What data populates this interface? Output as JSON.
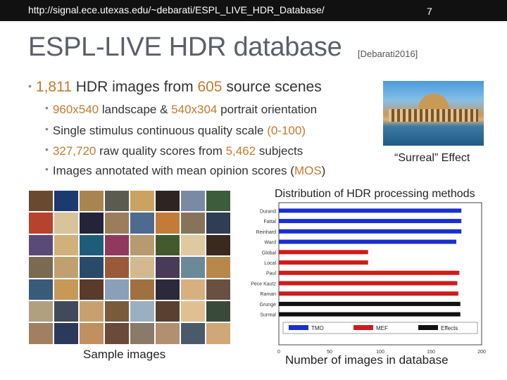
{
  "header": {
    "url": "http://signal.ece.utexas.edu/~debarati/ESPL_LIVE_HDR_Database/",
    "page_number": "7"
  },
  "slide": {
    "title": "ESPL-LIVE HDR database",
    "citation": "[Debarati2016]",
    "bullet": {
      "pre": "1,811",
      "mid1": " HDR images from ",
      "num2": "605",
      "post": " source scenes"
    },
    "subbullets": [
      {
        "a": "960x540",
        "b": " landscape & ",
        "c": "540x304",
        "d": " portrait orientation"
      },
      {
        "a": "Single stimulus continuous quality scale ",
        "b": "(0-100)"
      },
      {
        "a": "327,720",
        "b": " raw quality scores from ",
        "c": "5,462",
        "d": " subjects"
      },
      {
        "a": "Images annotated with mean opinion scores (",
        "b": "MOS",
        "c": ")"
      }
    ],
    "photo_caption": "“Surreal” Effect",
    "chart_caption": "Distribution of HDR processing methods",
    "sample_caption": "Sample images",
    "x_caption": "Number of images in database",
    "highlight_color": "#c37a2e",
    "sample_tile_colors": [
      "#6a4a2e",
      "#1d3a6e",
      "#a88550",
      "#5b5b50",
      "#c9a35f",
      "#2e2420",
      "#7b8aa4",
      "#3c5c3a",
      "#b7432f",
      "#d8c39a",
      "#23233a",
      "#9c7d5a",
      "#4e6b8f",
      "#c47b3a",
      "#86735a",
      "#2f3d55",
      "#5a4a78",
      "#d2b07a",
      "#1e5d7a",
      "#8f3a5c",
      "#b89a70",
      "#435a2e",
      "#e0c8a0",
      "#3a2a1e",
      "#7a6a52",
      "#c0a070",
      "#2a4a6a",
      "#9a5a3a",
      "#d4b890",
      "#4a3a5a",
      "#6a8a9a",
      "#b8884a",
      "#3a5a7a",
      "#c89858",
      "#5a3a2a",
      "#8aa0b8",
      "#a07040",
      "#2a2a3a",
      "#d8b080",
      "#6a5040",
      "#b0a080",
      "#404a5a",
      "#c8a070",
      "#7a5a3a",
      "#9ab0c0",
      "#5a4030",
      "#e0c090",
      "#3a4a3a",
      "#a08060",
      "#2a3a5a",
      "#c09060",
      "#6a4a3a",
      "#8a7a6a",
      "#b09070",
      "#4a5a6a",
      "#d0a878"
    ]
  },
  "chart_data": {
    "type": "bar",
    "orientation": "horizontal",
    "categories": [
      "Durand",
      "Fattal",
      "Reinhard",
      "Ward",
      "Global",
      "Local",
      "Paul",
      "Pece Kautz",
      "Raman",
      "Grunge",
      "Surreal"
    ],
    "values": [
      180,
      180,
      180,
      175,
      88,
      88,
      178,
      176,
      177,
      179,
      179
    ],
    "bar_groups": [
      "TMO",
      "TMO",
      "TMO",
      "TMO",
      "MEF",
      "MEF",
      "MEF",
      "MEF",
      "MEF",
      "Effects",
      "Effects"
    ],
    "series": [
      {
        "name": "TMO",
        "color": "#1a2fd0"
      },
      {
        "name": "MEF",
        "color": "#d01a1a"
      },
      {
        "name": "Effects",
        "color": "#111111"
      }
    ],
    "x_ticks": [
      0,
      50,
      100,
      150,
      200
    ],
    "xlim": [
      0,
      200
    ],
    "legend_position": "bottom-center",
    "xlabel": "",
    "ylabel": "",
    "title": ""
  }
}
